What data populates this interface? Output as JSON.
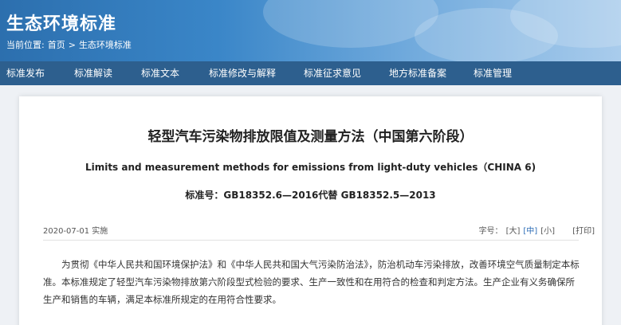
{
  "header": {
    "site_title": "生态环境标准",
    "breadcrumb_prefix": "当前位置:",
    "breadcrumb_home": "首页",
    "breadcrumb_sep": ">",
    "breadcrumb_current": "生态环境标准"
  },
  "nav": {
    "items": [
      "标准发布",
      "标准解读",
      "标准文本",
      "标准修改与解释",
      "标准征求意见",
      "地方标准备案",
      "标准管理"
    ]
  },
  "article": {
    "title": "轻型汽车污染物排放限值及测量方法（中国第六阶段）",
    "subtitle": "Limits and measurement methods for emissions from light-duty vehicles（CHINA 6)",
    "standard_no": "标准号：GB18352.6—2016代替 GB18352.5—2013",
    "date": "2020-07-01 实施",
    "font_size_label": "字号：",
    "font_large": "[大]",
    "font_medium": "[中]",
    "font_small": "[小]",
    "print": "[打印]",
    "body": "为贯彻《中华人民共和国环境保护法》和《中华人民共和国大气污染防治法》，防治机动车污染排放，改善环境空气质量制定本标准。本标准规定了轻型汽车污染物排放第六阶段型式检验的要求、生产一致性和在用符合的检查和判定方法。生产企业有义务确保所生产和销售的车辆，满足本标准所规定的在用符合性要求。"
  },
  "colors": {
    "nav_bg": "#2d5f8e",
    "accent": "#2a6bb5",
    "header_start": "#2c6fae"
  }
}
